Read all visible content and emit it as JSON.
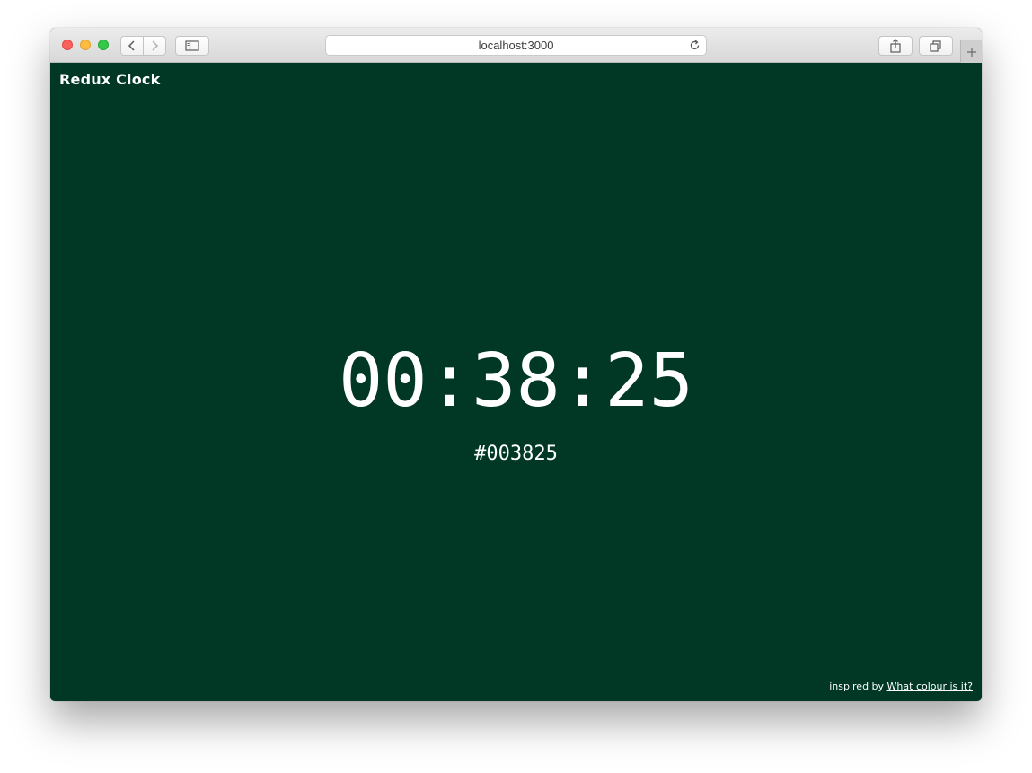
{
  "browser": {
    "address": "localhost:3000",
    "icons": {
      "back": "chevron-left-icon",
      "forward": "chevron-right-icon",
      "sidebar": "sidebar-icon",
      "reload": "reload-icon",
      "share": "share-icon",
      "tabs": "tabs-overview-icon",
      "new_tab": "plus-icon"
    }
  },
  "app": {
    "title": "Redux Clock",
    "time": "00:38:25",
    "hex": "#003825",
    "background_color": "#003825",
    "text_color": "#ffffff"
  },
  "footer": {
    "prefix": "inspired by",
    "link_text": "What colour is it?"
  }
}
